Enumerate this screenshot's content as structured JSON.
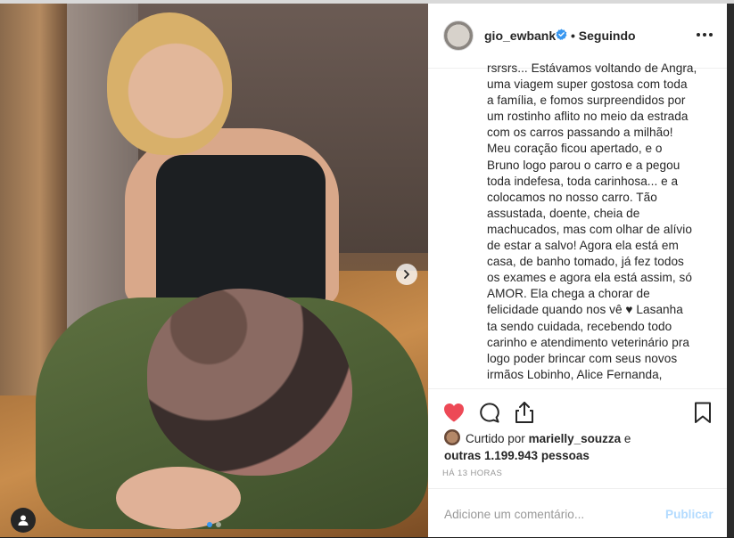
{
  "post": {
    "username": "gio_ewbank",
    "follow_status": "• Seguindo",
    "caption_lines": [
      "rsrsrs... Estávamos voltando de Angra,",
      "uma viagem super gostosa com toda",
      "a família, e fomos surpreendidos por",
      "um rostinho aflito no meio da estrada",
      "com os carros passando a milhão!",
      "Meu coração ficou apertado, e o",
      "Bruno logo parou o carro e a pegou",
      "toda indefesa, toda carinhosa... e a",
      "colocamos no nosso carro. Tão",
      "assustada, doente, cheia de",
      "machucados, mas com olhar de alívio",
      "de estar a salvo! Agora ela está em",
      "casa, de banho tomado, já fez todos",
      "os exames e agora ela está assim, só",
      "AMOR. Ela chega a chorar de",
      "felicidade quando nos vê ♥ Lasanha",
      "ta sendo cuidada, recebendo todo",
      "carinho e atendimento veterinário pra",
      "logo poder brincar com seus novos",
      "irmãos Lobinho, Alice Fernanda,"
    ],
    "likes": {
      "prefix": "Curtido por",
      "liker": "marielly_souzza",
      "connector": "e",
      "others": "outras 1.199.943 pessoas"
    },
    "time_ago": "HÁ 13 HORAS",
    "comment_placeholder": "Adicione um comentário...",
    "publish_label": "Publicar"
  },
  "carousel": {
    "total": 2,
    "current": 1
  },
  "icons": {
    "like": "heart-icon-filled",
    "comment": "comment-icon",
    "share": "share-icon",
    "save": "bookmark-icon",
    "more": "more-options-icon",
    "next": "chevron-right-icon",
    "user": "user-tag-icon",
    "verified": "verified-badge-icon"
  },
  "colors": {
    "like_red": "#ed4956",
    "verified_blue": "#3897f0",
    "publish_disabled": "#b3dbff",
    "carousel_active": "#3897f0"
  }
}
